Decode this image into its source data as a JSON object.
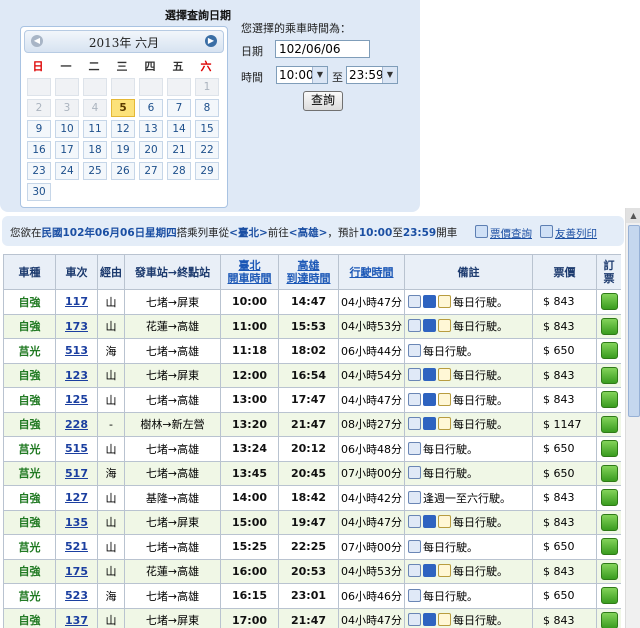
{
  "query": {
    "title": "選擇查詢日期",
    "calendar": {
      "prev_icon": "◀",
      "next_icon": "▶",
      "month_label": "2013年 六月",
      "weekdays": [
        "日",
        "一",
        "二",
        "三",
        "四",
        "五",
        "六"
      ],
      "rows": [
        [
          "",
          "",
          "",
          "",
          "",
          "",
          "1"
        ],
        [
          "2",
          "3",
          "4",
          "5",
          "6",
          "7",
          "8"
        ],
        [
          "9",
          "10",
          "11",
          "12",
          "13",
          "14",
          "15"
        ],
        [
          "16",
          "17",
          "18",
          "19",
          "20",
          "21",
          "22"
        ],
        [
          "23",
          "24",
          "25",
          "26",
          "27",
          "28",
          "29"
        ],
        [
          "30",
          "",
          "",
          "",
          "",
          "",
          ""
        ]
      ],
      "selected_day": "5"
    },
    "prompt": "您選擇的乘車時間為：",
    "date_label": "日期",
    "date_value": "102/06/06",
    "time_label": "時間",
    "time_from": "10:00",
    "to_label": "至",
    "time_to": "23:59",
    "submit_label": "查詢"
  },
  "info": {
    "p1": "您欲在",
    "date": "民國102年06月06日星期四",
    "p2": "搭乘列車從",
    "from": "<臺北>",
    "p3": "前往",
    "to": "<高雄>",
    "p4": "，預計",
    "tfrom": "10:00",
    "p5": "至",
    "tto": "23:59",
    "p6": "開車",
    "fare_link": "票價查詢",
    "print_link": "友善列印"
  },
  "table": {
    "headers": {
      "cls": "車種",
      "no": "車次",
      "via": "經由",
      "route": "發車站→終點站",
      "dep1": "臺北",
      "dep2": "開車時間",
      "arr1": "高雄",
      "arr2": "到達時間",
      "dur": "行駛時間",
      "note": "備註",
      "price": "票價",
      "book1": "訂",
      "book2": "票"
    },
    "rows": [
      {
        "cls": "自強",
        "no": "117",
        "via": "山",
        "route": "七堵→屏東",
        "dep": "10:00",
        "arr": "14:47",
        "dur": "04小時47分",
        "icons": [
          "info",
          "wheel",
          "bike"
        ],
        "note": "每日行駛。",
        "price": "$ 843"
      },
      {
        "cls": "自強",
        "no": "173",
        "via": "山",
        "route": "花蓮→高雄",
        "dep": "11:00",
        "arr": "15:53",
        "dur": "04小時53分",
        "icons": [
          "info",
          "wheel",
          "bike"
        ],
        "note": "每日行駛。",
        "price": "$ 843"
      },
      {
        "cls": "莒光",
        "no": "513",
        "via": "海",
        "route": "七堵→高雄",
        "dep": "11:18",
        "arr": "18:02",
        "dur": "06小時44分",
        "icons": [
          "info"
        ],
        "note": "每日行駛。",
        "price": "$ 650"
      },
      {
        "cls": "自強",
        "no": "123",
        "via": "山",
        "route": "七堵→屏東",
        "dep": "12:00",
        "arr": "16:54",
        "dur": "04小時54分",
        "icons": [
          "info",
          "wheel",
          "bike"
        ],
        "note": "每日行駛。",
        "price": "$ 843"
      },
      {
        "cls": "自強",
        "no": "125",
        "via": "山",
        "route": "七堵→高雄",
        "dep": "13:00",
        "arr": "17:47",
        "dur": "04小時47分",
        "icons": [
          "info",
          "wheel",
          "bike"
        ],
        "note": "每日行駛。",
        "price": "$ 843"
      },
      {
        "cls": "自強",
        "no": "228",
        "via": "-",
        "route": "樹林→新左營",
        "dep": "13:20",
        "arr": "21:47",
        "dur": "08小時27分",
        "icons": [
          "info",
          "wheel",
          "bike"
        ],
        "note": "每日行駛。",
        "price": "$ 1147"
      },
      {
        "cls": "莒光",
        "no": "515",
        "via": "山",
        "route": "七堵→高雄",
        "dep": "13:24",
        "arr": "20:12",
        "dur": "06小時48分",
        "icons": [
          "info"
        ],
        "note": "每日行駛。",
        "price": "$ 650"
      },
      {
        "cls": "莒光",
        "no": "517",
        "via": "海",
        "route": "七堵→高雄",
        "dep": "13:45",
        "arr": "20:45",
        "dur": "07小時00分",
        "icons": [
          "info"
        ],
        "note": "每日行駛。",
        "price": "$ 650"
      },
      {
        "cls": "自強",
        "no": "127",
        "via": "山",
        "route": "基隆→高雄",
        "dep": "14:00",
        "arr": "18:42",
        "dur": "04小時42分",
        "icons": [
          "info"
        ],
        "note": "逢週一至六行駛。",
        "price": "$ 843"
      },
      {
        "cls": "自強",
        "no": "135",
        "via": "山",
        "route": "七堵→屏東",
        "dep": "15:00",
        "arr": "19:47",
        "dur": "04小時47分",
        "icons": [
          "info",
          "wheel",
          "bike"
        ],
        "note": "每日行駛。",
        "price": "$ 843"
      },
      {
        "cls": "莒光",
        "no": "521",
        "via": "山",
        "route": "七堵→高雄",
        "dep": "15:25",
        "arr": "22:25",
        "dur": "07小時00分",
        "icons": [
          "info"
        ],
        "note": "每日行駛。",
        "price": "$ 650"
      },
      {
        "cls": "自強",
        "no": "175",
        "via": "山",
        "route": "花蓮→高雄",
        "dep": "16:00",
        "arr": "20:53",
        "dur": "04小時53分",
        "icons": [
          "info",
          "wheel",
          "bike"
        ],
        "note": "每日行駛。",
        "price": "$ 843"
      },
      {
        "cls": "莒光",
        "no": "523",
        "via": "海",
        "route": "七堵→高雄",
        "dep": "16:15",
        "arr": "23:01",
        "dur": "06小時46分",
        "icons": [
          "info"
        ],
        "note": "每日行駛。",
        "price": "$ 650"
      },
      {
        "cls": "自強",
        "no": "137",
        "via": "山",
        "route": "七堵→屏東",
        "dep": "17:00",
        "arr": "21:47",
        "dur": "04小時47分",
        "icons": [
          "info",
          "wheel",
          "bike"
        ],
        "note": "每日行駛。",
        "price": "$ 843"
      }
    ]
  },
  "scrollbar": {
    "up_icon": "▲"
  }
}
